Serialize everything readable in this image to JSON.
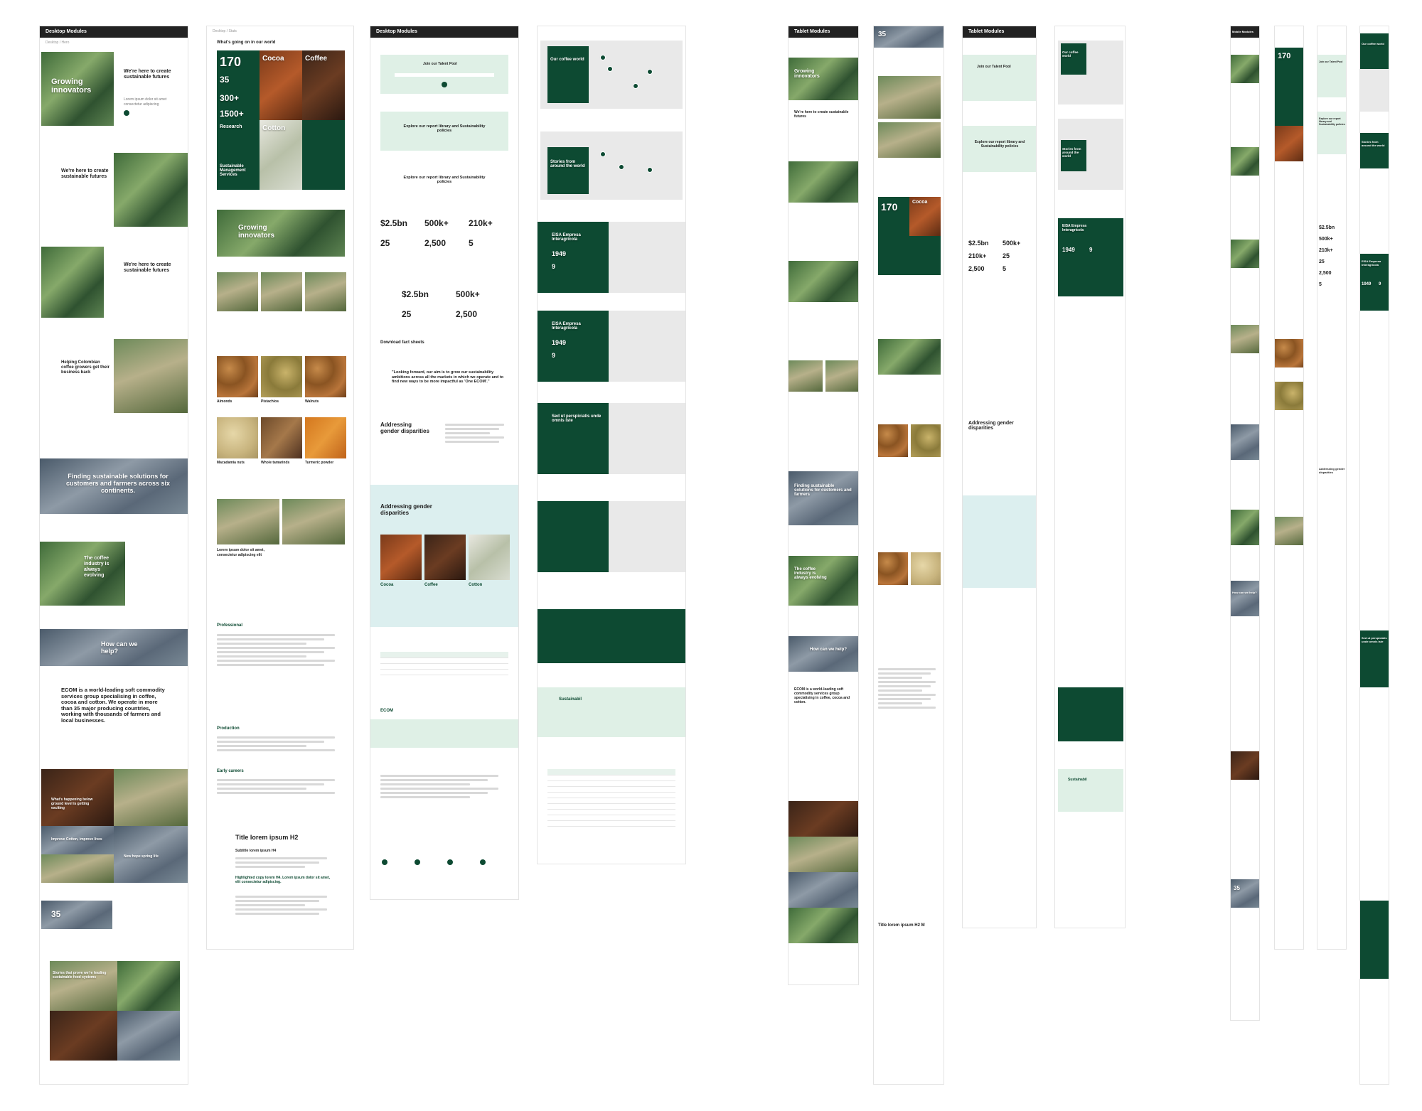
{
  "desktop_modules": {
    "header": "Desktop Modules",
    "hero_title": "Growing innovators",
    "hero_body": "We're here to create sustainable futures",
    "split_body": "We're here to create sustainable futures",
    "colombia": "Helping Colombian coffee growers get their business back",
    "banner": "Finding sustainable solutions for customers and farmers across six continents.",
    "coffee_industry": "The coffee industry is always evolving",
    "help": "How can we help?",
    "about": "ECOM is a world-leading soft commodity services group specialising in coffee, cocoa and cotton. We operate in more than 35 major producing countries, working with thousands of farmers and local businesses.",
    "tile1": "What's happening below ground level is getting exciting",
    "tile3": "Improve Cotton, improve lives",
    "tile4": "New hope spring life",
    "stat35": "35",
    "tile_bottom1": "Stories that prove we're leading sustainable food systems"
  },
  "col2": {
    "eyebrow": "What's going on in our world",
    "n170": "170",
    "n35": "35",
    "n300": "300+",
    "n1500": "1500+",
    "cocoa": "Cocoa",
    "coffee": "Coffee",
    "research": "Research",
    "cotton": "Cotton",
    "sustainable": "Sustainable Management Services",
    "growing": "Growing innovators",
    "almonds": "Almonds",
    "pistachios": "Pistachios",
    "walnuts": "Walnuts",
    "macadamia": "Macadamia nuts",
    "tamarind": "Whole tamarinds",
    "turmeric": "Turmeric powder",
    "lorem_card": "Lorem ipsum dolor sit amet, consectetur adipiscing elit",
    "professional": "Professional",
    "production": "Production",
    "early": "Early careers",
    "title_h2": "Title lorem ipsum H2",
    "subtitle": "Subtitle lorem ipsum H4",
    "highlight": "Highlighted copy lorem H4. Lorem ipsum dolor sit amet, elit consectetur adipiscing."
  },
  "col3": {
    "header": "Desktop Modules",
    "talent": "Join our Talent Pool",
    "report1": "Explore our report library and Sustainability policies",
    "report2": "Explore our report library and Sustainability policies",
    "s25bn": "$2.5bn",
    "s500k": "500k+",
    "s210k": "210k+",
    "s25": "25",
    "s2500": "2,500",
    "s5": "5",
    "download": "Download fact sheets",
    "quote": "\"Looking forward, our aim is to grow our sustainability ambitions across all the markets in which we operate and to find new ways to be more impactful as 'One ECOM'.\"",
    "gender": "Addressing gender disparities",
    "gender2": "Addressing gender disparities",
    "cocoa": "Cocoa",
    "coffee": "Coffee",
    "cotton": "Cotton",
    "logo": "ECOM"
  },
  "col4": {
    "map1": "Our coffee world",
    "map2": "Stories from around the world",
    "eisa1": "EISA Empresa Interagrícola",
    "y1949": "1949",
    "n9": "9",
    "eisa2": "EISA Empresa Interagrícola",
    "sed": "Sed ut perspiciatis unde omnis iste",
    "search": "Sustainabil"
  },
  "tablet": {
    "header": "Tablet Modules",
    "header2": "Tablet Modules",
    "growing": "Growing innovators",
    "create": "We're here to create sustainable futures",
    "finding": "Finding sustainable solutions for customers and farmers",
    "coffee_industry": "The coffee industry is always evolving",
    "help": "How can we help?",
    "about": "ECOM is a world-leading soft commodity services group specialising in coffee, cocoa and cotton.",
    "n35": "35",
    "n170": "170",
    "cocoa": "Cocoa",
    "talent": "Join our Talent Pool",
    "report": "Explore our report library and Sustainability policies",
    "s25bn": "$2.5bn",
    "s500k": "500k+",
    "s210k": "210k+",
    "s25": "25",
    "s2500": "2,500",
    "s5": "5",
    "gender": "Addressing gender disparities",
    "map1": "Our coffee world",
    "map2": "Stories from around the world",
    "eisa": "EISA Empresa Interagrícola",
    "y1949": "1949",
    "n9": "9",
    "title": "Title lorem ipsum H2 M",
    "search": "Sustainabil"
  },
  "mobile": {
    "header": "Mobile Modules",
    "n170": "170",
    "talent": "Join our Talent Pool",
    "report": "Explore our report library and Sustainability policies",
    "s25bn": "$2.5bn",
    "s500k": "500k+",
    "s210k": "210k+",
    "s25": "25",
    "s2500": "2,500",
    "s5": "5",
    "map": "Our coffee world",
    "stories": "Stories from around the world",
    "eisa": "EISA Empresa Interagrícola",
    "y1949": "1949",
    "n9": "9",
    "sed": "Sed ut perspiciatis unde omnis iste",
    "gender": "Addressing gender disparities",
    "help": "How can we help?",
    "n35": "35"
  }
}
